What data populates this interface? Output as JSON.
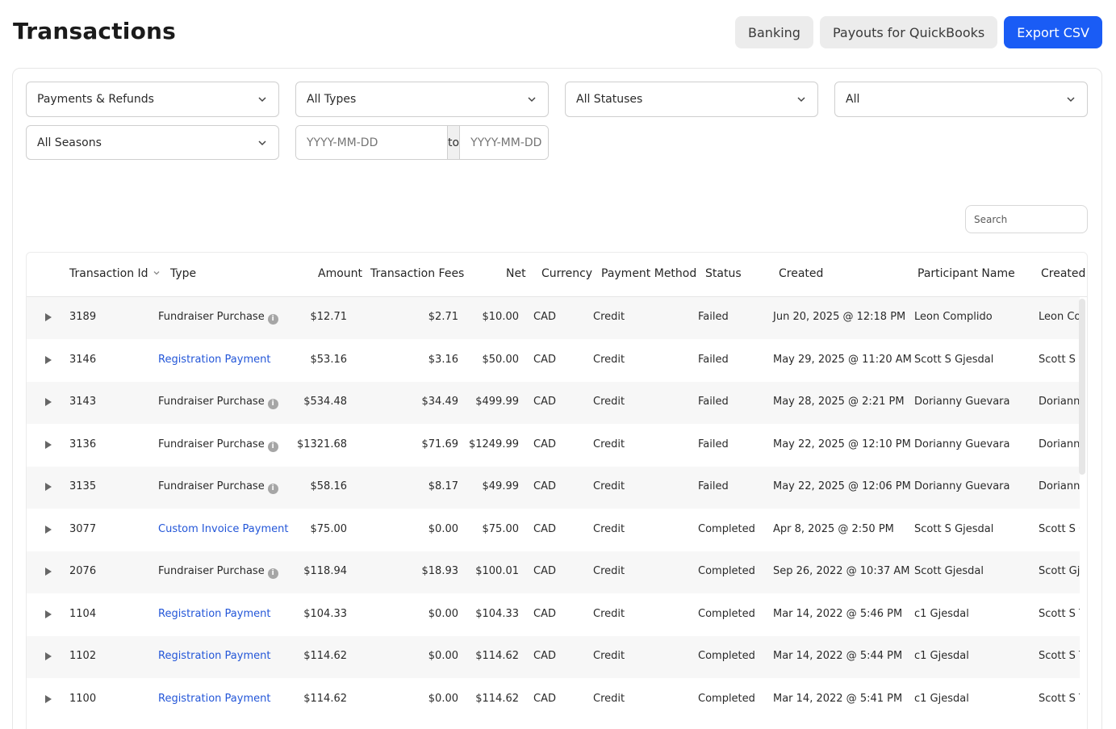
{
  "header": {
    "title": "Transactions",
    "banking_label": "Banking",
    "payouts_label": "Payouts for QuickBooks",
    "export_label": "Export CSV"
  },
  "filters": {
    "category": "Payments & Refunds",
    "type": "All Types",
    "status": "All Statuses",
    "scope": "All",
    "season": "All Seasons",
    "date_from_placeholder": "YYYY-MM-DD",
    "date_to_label": "to",
    "date_to_placeholder": "YYYY-MM-DD"
  },
  "search": {
    "placeholder": "Search"
  },
  "table": {
    "columns": {
      "transaction_id": "Transaction Id",
      "type": "Type",
      "amount": "Amount",
      "fees": "Transaction Fees",
      "net": "Net",
      "currency": "Currency",
      "payment_method": "Payment Method",
      "status": "Status",
      "created": "Created",
      "participant": "Participant Name",
      "created_by": "Created"
    },
    "rows": [
      {
        "id": "3189",
        "type": "Fundraiser Purchase",
        "type_link": false,
        "amount": "$12.71",
        "fees": "$2.71",
        "net": "$10.00",
        "currency": "CAD",
        "method": "Credit",
        "status": "Failed",
        "created": "Jun 20, 2025 @ 12:18 PM",
        "participant": "Leon Complido",
        "created_by": "Leon Complido"
      },
      {
        "id": "3146",
        "type": "Registration Payment",
        "type_link": true,
        "amount": "$53.16",
        "fees": "$3.16",
        "net": "$50.00",
        "currency": "CAD",
        "method": "Credit",
        "status": "Failed",
        "created": "May 29, 2025 @ 11:20 AM",
        "participant": "Scott S Gjesdal",
        "created_by": "Scott S Gjesdal"
      },
      {
        "id": "3143",
        "type": "Fundraiser Purchase",
        "type_link": false,
        "amount": "$534.48",
        "fees": "$34.49",
        "net": "$499.99",
        "currency": "CAD",
        "method": "Credit",
        "status": "Failed",
        "created": "May 28, 2025 @ 2:21 PM",
        "participant": "Dorianny Guevara",
        "created_by": "Dorianny Guevara"
      },
      {
        "id": "3136",
        "type": "Fundraiser Purchase",
        "type_link": false,
        "amount": "$1321.68",
        "fees": "$71.69",
        "net": "$1249.99",
        "currency": "CAD",
        "method": "Credit",
        "status": "Failed",
        "created": "May 22, 2025 @ 12:10 PM",
        "participant": "Dorianny Guevara",
        "created_by": "Dorianny Guevara"
      },
      {
        "id": "3135",
        "type": "Fundraiser Purchase",
        "type_link": false,
        "amount": "$58.16",
        "fees": "$8.17",
        "net": "$49.99",
        "currency": "CAD",
        "method": "Credit",
        "status": "Failed",
        "created": "May 22, 2025 @ 12:06 PM",
        "participant": "Dorianny Guevara",
        "created_by": "Dorianny Guevara"
      },
      {
        "id": "3077",
        "type": "Custom Invoice Payment",
        "type_link": true,
        "amount": "$75.00",
        "fees": "$0.00",
        "net": "$75.00",
        "currency": "CAD",
        "method": "Credit",
        "status": "Completed",
        "created": "Apr 8, 2025 @ 2:50 PM",
        "participant": "Scott S Gjesdal",
        "created_by": "Scott S Gjesdal"
      },
      {
        "id": "2076",
        "type": "Fundraiser Purchase",
        "type_link": false,
        "amount": "$118.94",
        "fees": "$18.93",
        "net": "$100.01",
        "currency": "CAD",
        "method": "Credit",
        "status": "Completed",
        "created": "Sep 26, 2022 @ 10:37 AM",
        "participant": "Scott Gjesdal",
        "created_by": "Scott Gjesdal"
      },
      {
        "id": "1104",
        "type": "Registration Payment",
        "type_link": true,
        "amount": "$104.33",
        "fees": "$0.00",
        "net": "$104.33",
        "currency": "CAD",
        "method": "Credit",
        "status": "Completed",
        "created": "Mar 14, 2022 @ 5:46 PM",
        "participant": "c1 Gjesdal",
        "created_by": "Scott S Test"
      },
      {
        "id": "1102",
        "type": "Registration Payment",
        "type_link": true,
        "amount": "$114.62",
        "fees": "$0.00",
        "net": "$114.62",
        "currency": "CAD",
        "method": "Credit",
        "status": "Completed",
        "created": "Mar 14, 2022 @ 5:44 PM",
        "participant": "c1 Gjesdal",
        "created_by": "Scott S Test"
      },
      {
        "id": "1100",
        "type": "Registration Payment",
        "type_link": true,
        "amount": "$114.62",
        "fees": "$0.00",
        "net": "$114.62",
        "currency": "CAD",
        "method": "Credit",
        "status": "Completed",
        "created": "Mar 14, 2022 @ 5:41 PM",
        "participant": "c1 Gjesdal",
        "created_by": "Scott S Test"
      }
    ]
  },
  "icons": {
    "chevron": "chevron-down-icon",
    "expander": "expand-row-icon",
    "info": "info-icon",
    "sort": "sort-icon"
  }
}
